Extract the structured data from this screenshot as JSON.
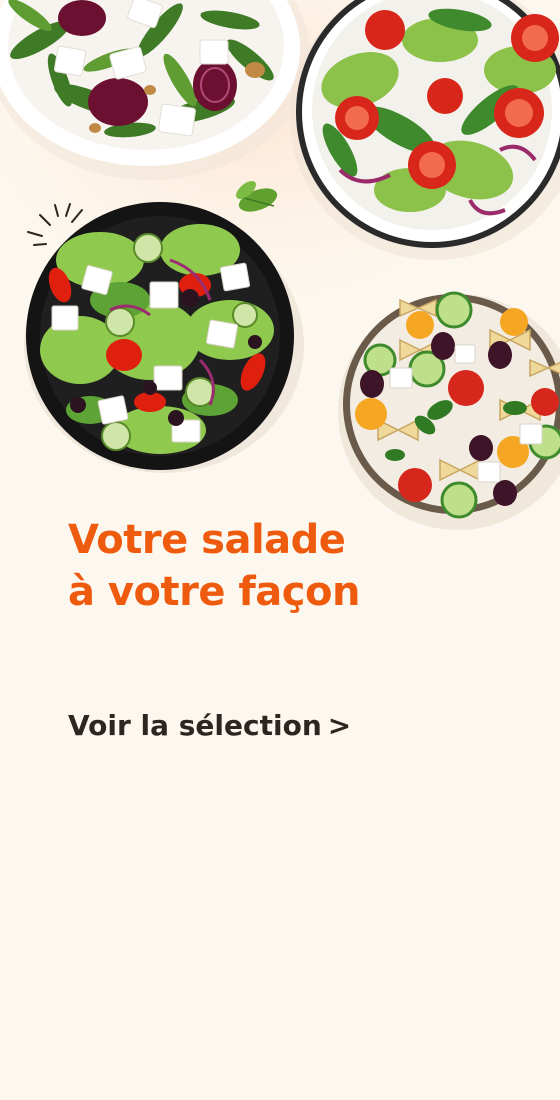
{
  "banner": {
    "headline_line1": "Votre salade",
    "headline_line2": "à votre façon",
    "cta_label": "Voir la sélection",
    "cta_chevron": ">"
  },
  "colors": {
    "background": "#fdf8ef",
    "headline": "#ee5a0e",
    "cta": "#2c2620"
  },
  "images": [
    "beetroot-arugula-salad-plate",
    "tomato-lettuce-salad-bowl",
    "greek-salad-black-bowl",
    "pasta-salad-bowl"
  ]
}
